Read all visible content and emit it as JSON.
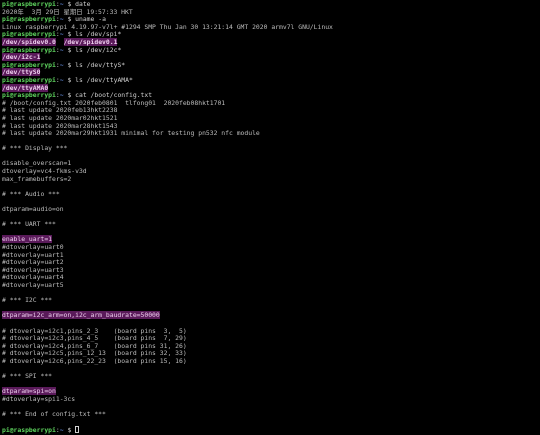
{
  "prompt": {
    "user_host": "pi@raspberrypi",
    "separator": ":",
    "path": "~",
    "symbol": " $ "
  },
  "lines": [
    {
      "kind": "prompt",
      "cmd": "date"
    },
    {
      "kind": "out",
      "text": "2020年  3月 29日 星期日 19:57:33 HKT"
    },
    {
      "kind": "prompt",
      "cmd": "uname -a"
    },
    {
      "kind": "out",
      "text": "Linux raspberrypi 4.19.97-v7l+ #1294 SMP Thu Jan 30 13:21:14 GMT 2020 armv7l GNU/Linux"
    },
    {
      "kind": "prompt",
      "cmd": "ls /dev/spi*"
    },
    {
      "kind": "devs",
      "items": [
        "/dev/spidev0.0",
        "/dev/spidev0.1"
      ]
    },
    {
      "kind": "prompt",
      "cmd": "ls /dev/i2c*"
    },
    {
      "kind": "devs",
      "items": [
        "/dev/i2c-1"
      ]
    },
    {
      "kind": "prompt",
      "cmd": "ls /dev/ttyS*"
    },
    {
      "kind": "devs",
      "items": [
        "/dev/ttyS0"
      ]
    },
    {
      "kind": "prompt",
      "cmd": "ls /dev/ttyAMA*"
    },
    {
      "kind": "devs",
      "items": [
        "/dev/ttyAMA0"
      ]
    },
    {
      "kind": "prompt",
      "cmd": "cat /boot/config.txt"
    },
    {
      "kind": "out",
      "text": "# /boot/config.txt 2020feb0801  tlfong01  2020feb08hkt1701"
    },
    {
      "kind": "out",
      "text": "# last update 2020feb13hkt2238"
    },
    {
      "kind": "out",
      "text": "# last update 2020mar02hkt1521"
    },
    {
      "kind": "out",
      "text": "# last update 2020mar28hkt1543"
    },
    {
      "kind": "out",
      "text": "# last update 2020mar29hkt1931 minimal for testing pn532 nfc module"
    },
    {
      "kind": "out",
      "text": ""
    },
    {
      "kind": "out",
      "text": "# *** Display ***"
    },
    {
      "kind": "out",
      "text": ""
    },
    {
      "kind": "out",
      "text": "disable_overscan=1"
    },
    {
      "kind": "out",
      "text": "dtoverlay=vc4-fkms-v3d"
    },
    {
      "kind": "out",
      "text": "max_framebuffers=2"
    },
    {
      "kind": "out",
      "text": ""
    },
    {
      "kind": "out",
      "text": "# *** Audio ***"
    },
    {
      "kind": "out",
      "text": ""
    },
    {
      "kind": "out",
      "text": "dtparam=audio=on"
    },
    {
      "kind": "out",
      "text": ""
    },
    {
      "kind": "out",
      "text": "# *** UART ***"
    },
    {
      "kind": "out",
      "text": ""
    },
    {
      "kind": "hl",
      "text": "enable_uart=1"
    },
    {
      "kind": "out",
      "text": "#dtoverlay=uart0"
    },
    {
      "kind": "out",
      "text": "#dtoverlay=uart1"
    },
    {
      "kind": "out",
      "text": "#dtoverlay=uart2"
    },
    {
      "kind": "out",
      "text": "#dtoverlay=uart3"
    },
    {
      "kind": "out",
      "text": "#dtoverlay=uart4"
    },
    {
      "kind": "out",
      "text": "#dtoverlay=uart5"
    },
    {
      "kind": "out",
      "text": ""
    },
    {
      "kind": "out",
      "text": "# *** I2C ***"
    },
    {
      "kind": "out",
      "text": ""
    },
    {
      "kind": "hl",
      "text": "dtparam=i2c_arm=on,i2c_arm_baudrate=50000"
    },
    {
      "kind": "out",
      "text": ""
    },
    {
      "kind": "out",
      "text": "# dtoverlay=i2c1,pins_2_3    (board pins  3,  5)"
    },
    {
      "kind": "out",
      "text": "# dtoverlay=i2c3,pins_4_5    (board pins  7, 29)"
    },
    {
      "kind": "out",
      "text": "# dtoverlay=i2c4,pins_6_7    (board pins 31, 26)"
    },
    {
      "kind": "out",
      "text": "# dtoverlay=i2c5,pins_12_13  (board pins 32, 33)"
    },
    {
      "kind": "out",
      "text": "# dtoverlay=i2c6,pins_22_23  (board pins 15, 16)"
    },
    {
      "kind": "out",
      "text": ""
    },
    {
      "kind": "out",
      "text": "# *** SPI ***"
    },
    {
      "kind": "out",
      "text": ""
    },
    {
      "kind": "hl",
      "text": "dtparam=spi=on"
    },
    {
      "kind": "out",
      "text": "#dtoverlay=spi1-3cs"
    },
    {
      "kind": "out",
      "text": ""
    },
    {
      "kind": "out",
      "text": "# *** End of config.txt ***"
    },
    {
      "kind": "out",
      "text": ""
    },
    {
      "kind": "prompt",
      "cmd": ""
    }
  ]
}
